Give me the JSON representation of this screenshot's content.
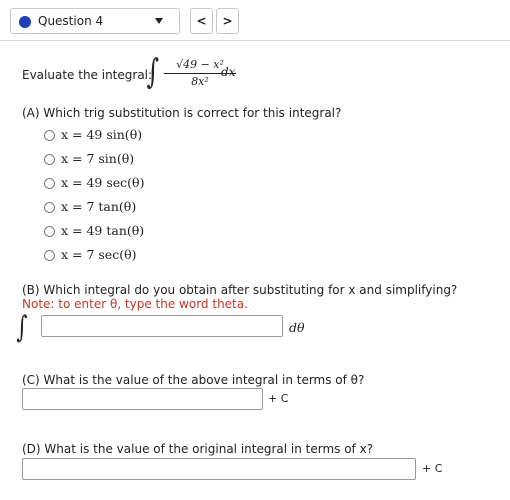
{
  "nav": {
    "question_label": "Question 4",
    "prev_symbol": "<",
    "next_symbol": ">"
  },
  "problem": {
    "prompt": "Evaluate the integral:",
    "numerator": "√49 − x²",
    "denominator": "8x²",
    "differential": "dx"
  },
  "part_a": {
    "question": "(A) Which trig substitution is correct for this integral?",
    "options": [
      "x = 49 sin(θ)",
      "x = 7 sin(θ)",
      "x = 49 sec(θ)",
      "x = 7 tan(θ)",
      "x = 49 tan(θ)",
      "x = 7 sec(θ)"
    ]
  },
  "part_b": {
    "question": "(B) Which integral do you obtain after substituting for x and simplifying?",
    "note": "Note: to enter θ, type the word theta.",
    "integral_symbol": "∫",
    "input_value": "",
    "differential": "dθ"
  },
  "part_c": {
    "question": "(C) What is the value of the above integral in terms of θ?",
    "input_value": "",
    "suffix": "+ C"
  },
  "part_d": {
    "question": "(D) What is the value of the original integral in terms of x?",
    "input_value": "",
    "suffix": "+ C"
  },
  "colors": {
    "accent": "#1f3db5",
    "note": "#c0392b"
  }
}
